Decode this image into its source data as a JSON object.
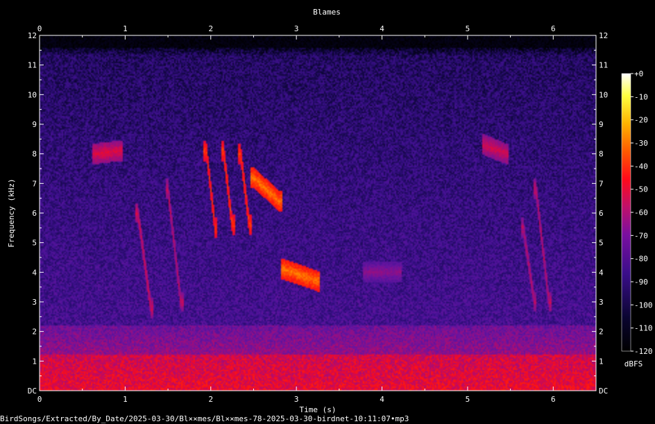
{
  "chart_data": {
    "type": "heatmap",
    "title": "Blames",
    "xlabel": "Time (s)",
    "ylabel": "Frequency (kHz)",
    "x_ticks": [
      "0",
      "1",
      "2",
      "3",
      "4",
      "5",
      "6"
    ],
    "y_ticks": [
      "DC",
      "1",
      "2",
      "3",
      "4",
      "5",
      "6",
      "7",
      "8",
      "9",
      "10",
      "11",
      "12"
    ],
    "xlim": [
      0,
      6.5
    ],
    "ylim": [
      0,
      12
    ],
    "colorbar": {
      "label": "dBFS",
      "ticks": [
        "+0",
        "-10",
        "-20",
        "-30",
        "-40",
        "-50",
        "-60",
        "-70",
        "-80",
        "-90",
        "-100",
        "-110",
        "-120"
      ],
      "range": [
        -120,
        0
      ]
    },
    "noise_ceiling_khz": 11.6,
    "calls": [
      {
        "name": "whistle",
        "t0": 0.65,
        "t1": 0.95,
        "f0": 8.0,
        "f1": 8.1,
        "level": -58
      },
      {
        "name": "descending",
        "t0": 1.15,
        "t1": 1.3,
        "f0": 6.0,
        "f1": 2.8,
        "level": -60
      },
      {
        "name": "descending",
        "t0": 1.5,
        "t1": 1.65,
        "f0": 6.8,
        "f1": 3.0,
        "level": -62
      },
      {
        "name": "trill",
        "t0": 1.95,
        "t1": 2.05,
        "f0": 8.1,
        "f1": 5.5,
        "level": -45
      },
      {
        "name": "trill",
        "t0": 2.15,
        "t1": 2.25,
        "f0": 8.1,
        "f1": 5.6,
        "level": -45
      },
      {
        "name": "trill",
        "t0": 2.35,
        "t1": 2.45,
        "f0": 8.0,
        "f1": 5.6,
        "level": -45
      },
      {
        "name": "descending",
        "t0": 2.5,
        "t1": 2.8,
        "f0": 7.2,
        "f1": 6.4,
        "level": -38
      },
      {
        "name": "descending",
        "t0": 2.85,
        "t1": 3.25,
        "f0": 4.1,
        "f1": 3.7,
        "level": -38
      },
      {
        "name": "tone",
        "t0": 3.8,
        "t1": 4.2,
        "f0": 4.0,
        "f1": 4.0,
        "level": -72
      },
      {
        "name": "whistle",
        "t0": 5.2,
        "t1": 5.45,
        "f0": 8.3,
        "f1": 8.0,
        "level": -60
      },
      {
        "name": "descending",
        "t0": 5.8,
        "t1": 5.95,
        "f0": 6.8,
        "f1": 3.0,
        "level": -62
      },
      {
        "name": "descending",
        "t0": 5.65,
        "t1": 5.78,
        "f0": 5.5,
        "f1": 3.0,
        "level": -64
      }
    ]
  },
  "footer": {
    "filepath": "BirdSongs/Extracted/By_Date/2025-03-30/Bl××mes/Bl××mes-78-2025-03-30-birdnet-10:11:07•mp3"
  }
}
